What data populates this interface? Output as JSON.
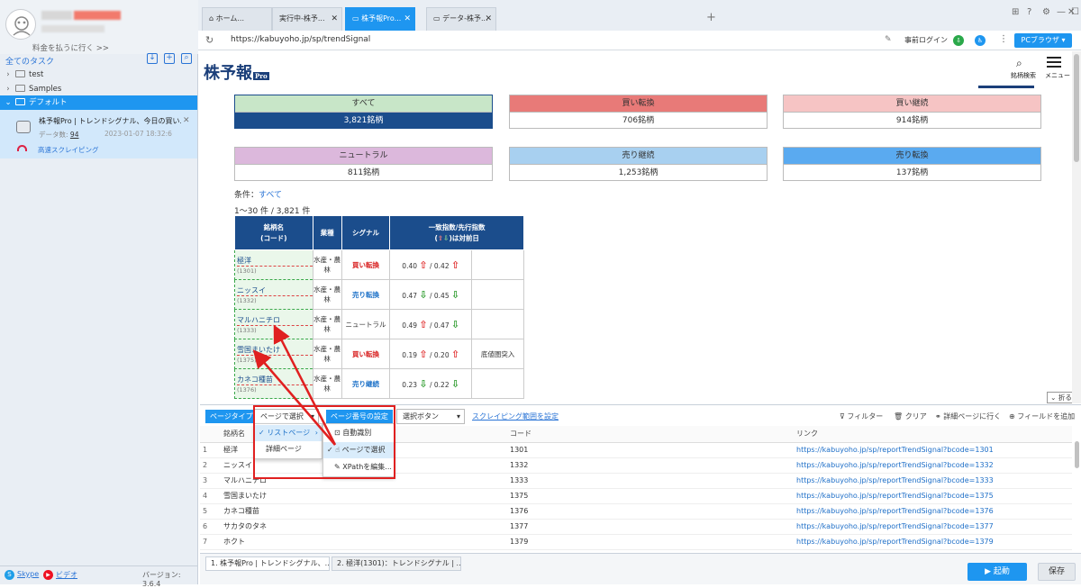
{
  "sidebar": {
    "upgrade": "料金を払うに行く >>",
    "all_tasks": "全てのタスク",
    "tree": [
      {
        "label": "test",
        "expanded": false
      },
      {
        "label": "Samples",
        "expanded": false
      },
      {
        "label": "デフォルト",
        "expanded": true,
        "selected": true
      }
    ],
    "task": {
      "title": "株予報Pro | トレンドシグナル、今日の買い...",
      "data_count_label": "データ数:",
      "data_count": "94",
      "time": "2023-01-07 18:32:6",
      "mode": "高速スクレイピング"
    },
    "footer": {
      "skype": "Skype",
      "video": "ビデオ",
      "version": "バージョン: 3.6.4"
    }
  },
  "browser": {
    "tabs": [
      {
        "label": "ホーム...",
        "active": false
      },
      {
        "label": "実行中-株予...",
        "active": false
      },
      {
        "label": "株予報Pro...",
        "active": true
      },
      {
        "label": "データ-株予...",
        "active": false
      }
    ],
    "url": "https://kabuyoho.jp/sp/trendSignal",
    "prelogin": "事前ログイン",
    "pc_browser": "PCブラウザ"
  },
  "webpage": {
    "logo": "株予報",
    "logo_pro": "Pro",
    "search_label": "銘柄検索",
    "menu_label": "メニュー",
    "categories": [
      {
        "label": "すべて",
        "count": "3,821銘柄",
        "head_color": "#c8e6c8",
        "selected": true
      },
      {
        "label": "買い転換",
        "count": "706銘柄",
        "head_color": "#e87a78"
      },
      {
        "label": "買い継続",
        "count": "914銘柄",
        "head_color": "#f6c4c4"
      },
      {
        "label": "ニュートラル",
        "count": "811銘柄",
        "head_color": "#dcb8dc"
      },
      {
        "label": "売り継続",
        "count": "1,253銘柄",
        "head_color": "#a8d0f0"
      },
      {
        "label": "売り転換",
        "count": "137銘柄",
        "head_color": "#5aaaf0"
      }
    ],
    "condition_label": "条件：",
    "condition_value": "すべて",
    "range": "1～30 件 / 3,821 件",
    "table_headers": [
      "銘柄名\n(コード)",
      "業種",
      "シグナル",
      "一致指数/先行指数\n(⇧⇩)は対前日"
    ],
    "rows": [
      {
        "name": "極洋",
        "code": "(1301)",
        "sector": "水産・農林",
        "signal": "買い転換",
        "sig": "buy",
        "a": "0.40",
        "ad": "up",
        "b": "0.42",
        "bd": "up",
        "note": ""
      },
      {
        "name": "ニッスイ",
        "code": "(1332)",
        "sector": "水産・農林",
        "signal": "売り転換",
        "sig": "sell",
        "a": "0.47",
        "ad": "dn",
        "b": "0.45",
        "bd": "dn",
        "note": ""
      },
      {
        "name": "マルハニチロ",
        "code": "(1333)",
        "sector": "水産・農林",
        "signal": "ニュートラル",
        "sig": "neutral",
        "a": "0.49",
        "ad": "up",
        "b": "0.47",
        "bd": "dn",
        "note": ""
      },
      {
        "name": "雪国まいたけ",
        "code": "(1375)",
        "sector": "水産・農林",
        "signal": "買い転換",
        "sig": "buy",
        "a": "0.19",
        "ad": "up",
        "b": "0.20",
        "bd": "up",
        "note": "底値圏突入"
      },
      {
        "name": "カネコ種苗",
        "code": "(1376)",
        "sector": "水産・農林",
        "signal": "売り継続",
        "sig": "sell",
        "a": "0.23",
        "ad": "dn",
        "b": "0.22",
        "bd": "dn",
        "note": ""
      }
    ],
    "fold_label": "折る"
  },
  "toolbar": {
    "page_type": "ページタイプ",
    "page_type_value": "ページで選択",
    "page_number_setting": "ページ番号の設定",
    "button_select": "選択ボタン",
    "scrape_range": "スクレイピング範囲を設定",
    "filter": "フィルター",
    "clear": "クリア",
    "detail": "詳細ページに行く",
    "add_field": "フィールドを追加"
  },
  "dropdown": {
    "primary": [
      "リストページ",
      "詳細ページ"
    ],
    "secondary": [
      "自動識別",
      "ページで選択",
      "XPathを編集..."
    ]
  },
  "data_table": {
    "columns": [
      "銘柄名",
      "コード",
      "リンク"
    ],
    "rows": [
      [
        "1",
        "極洋",
        "1301",
        "https://kabuyoho.jp/sp/reportTrendSignal?bcode=1301"
      ],
      [
        "2",
        "ニッスイ",
        "1332",
        "https://kabuyoho.jp/sp/reportTrendSignal?bcode=1332"
      ],
      [
        "3",
        "マルハニチロ",
        "1333",
        "https://kabuyoho.jp/sp/reportTrendSignal?bcode=1333"
      ],
      [
        "4",
        "雪国まいたけ",
        "1375",
        "https://kabuyoho.jp/sp/reportTrendSignal?bcode=1375"
      ],
      [
        "5",
        "カネコ種苗",
        "1376",
        "https://kabuyoho.jp/sp/reportTrendSignal?bcode=1376"
      ],
      [
        "6",
        "サカタのタネ",
        "1377",
        "https://kabuyoho.jp/sp/reportTrendSignal?bcode=1377"
      ],
      [
        "7",
        "ホクト",
        "1379",
        "https://kabuyoho.jp/sp/reportTrendSignal?bcode=1379"
      ]
    ]
  },
  "bottom": {
    "tabs": [
      "1. 株予報Pro | トレンドシグナル、...",
      "2. 極洋(1301)：トレンドシグナル | ..."
    ],
    "start": "▶ 起動",
    "save": "保存"
  }
}
